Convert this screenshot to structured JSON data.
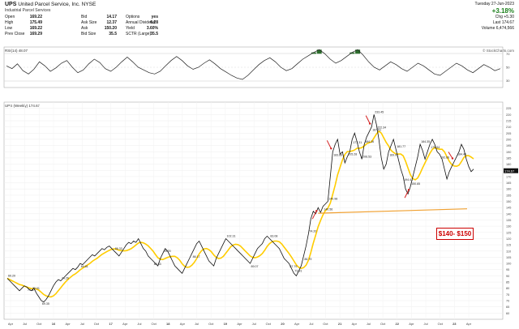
{
  "header": {
    "ticker": "UPS",
    "company": "United Parcel Service, Inc. NYSE",
    "industry": "Industrial Parcel Services",
    "credit": "© StockCharts.com",
    "date": "Tuesday 27-Jun-2023",
    "change_pct": "+3.18%",
    "change_abs": "+5.30",
    "quotes_left": [
      {
        "k": "Open",
        "v": "169.22"
      },
      {
        "k": "High",
        "v": "175.49"
      },
      {
        "k": "Low",
        "v": "169.22"
      },
      {
        "k": "Prev Close",
        "v": "169.29"
      }
    ],
    "quotes_mid": [
      {
        "k": "Bid",
        "v": "14.17"
      },
      {
        "k": "Ask Size",
        "v": "12.37"
      },
      {
        "k": "Ask",
        "v": "150.20"
      },
      {
        "k": "Bid Size",
        "v": "35.5"
      }
    ],
    "quotes_mid2": [
      {
        "k": "P/E",
        "v": "yes"
      },
      {
        "k": "EPS",
        "v": "6.28"
      },
      {
        "k": "Mkt Cap",
        "v": "3.60%"
      },
      {
        "k": "Last Size",
        "v": "35.5"
      }
    ],
    "quotes_mid3": [
      {
        "k": "Options",
        "v": "yes"
      },
      {
        "k": "Annual Dividend",
        "v": "6.28"
      },
      {
        "k": "Yield",
        "v": "3.60%"
      },
      {
        "k": "SCTR (Large)",
        "v": "35.5"
      }
    ],
    "quotes_right": [
      {
        "k": "Chg",
        "v": "+5.30"
      },
      {
        "k": "Last",
        "v": "174.67"
      },
      {
        "k": "Volume",
        "v": "6,474,566"
      }
    ]
  },
  "rsi_label": "RSI(14) 48.07",
  "price_label": "UPS (Weekly) 174.67",
  "price_tag": "174.67",
  "zone_label": "$140- $150",
  "colors": {
    "price_line": "#111111",
    "ma": "#ffcc00",
    "support": "#f0a030",
    "rsi_fill": "#2d6e2d",
    "arrow": "#d42020"
  },
  "chart_data": {
    "type": "line",
    "rsi": {
      "ylim": [
        20,
        80
      ],
      "ticks": [
        30,
        50,
        70
      ],
      "values": [
        52,
        48,
        55,
        45,
        40,
        47,
        58,
        52,
        44,
        49,
        56,
        60,
        50,
        42,
        46,
        55,
        62,
        57,
        48,
        44,
        50,
        58,
        65,
        58,
        50,
        46,
        42,
        40,
        44,
        52,
        60,
        66,
        60,
        52,
        47,
        50,
        56,
        61,
        55,
        48,
        43,
        38,
        34,
        32,
        38,
        46,
        54,
        60,
        64,
        58,
        50,
        45,
        48,
        55,
        62,
        67,
        72,
        76,
        70,
        62,
        56,
        60,
        66,
        72,
        76,
        68,
        58,
        50,
        46,
        52,
        58,
        54,
        48,
        44,
        50,
        56,
        52,
        46,
        40,
        38,
        44,
        50,
        56,
        52,
        46,
        42,
        48,
        54,
        50,
        45,
        48
      ]
    },
    "price": {
      "ylim": [
        55,
        230
      ],
      "y_ticks": [
        60,
        65,
        70,
        75,
        80,
        85,
        90,
        95,
        100,
        105,
        110,
        115,
        120,
        125,
        130,
        135,
        140,
        145,
        150,
        155,
        160,
        165,
        170,
        175,
        180,
        185,
        190,
        195,
        200,
        205,
        210,
        215,
        220,
        225
      ],
      "x_ticks": [
        "Apr",
        "Jul",
        "Oct",
        "16",
        "Apr",
        "Jul",
        "Oct",
        "17",
        "Apr",
        "Jul",
        "Oct",
        "18",
        "Apr",
        "Jul",
        "Oct",
        "19",
        "Apr",
        "Jul",
        "Oct",
        "20",
        "Apr",
        "Jul",
        "Oct",
        "21",
        "Apr",
        "Jul",
        "Oct",
        "22",
        "Apr",
        "Jul",
        "Oct",
        "23",
        "Apr"
      ],
      "points": [
        88,
        86,
        84,
        82,
        80,
        78,
        80,
        82,
        81,
        79,
        78,
        80,
        76,
        73,
        70,
        69,
        71,
        74,
        78,
        82,
        85,
        87,
        86,
        88,
        90,
        92,
        94,
        96,
        95,
        97,
        100,
        99,
        101,
        103,
        105,
        107,
        106,
        108,
        110,
        112,
        111,
        113,
        114,
        112,
        110,
        108,
        106,
        109,
        112,
        115,
        117,
        116,
        118,
        117,
        120,
        116,
        112,
        110,
        106,
        104,
        102,
        100,
        98,
        104,
        108,
        112,
        110,
        106,
        102,
        98,
        96,
        94,
        92,
        96,
        100,
        104,
        108,
        112,
        116,
        118,
        114,
        110,
        106,
        102,
        100,
        98,
        104,
        108,
        112,
        116,
        120,
        118,
        116,
        114,
        112,
        110,
        108,
        106,
        104,
        102,
        100,
        104,
        108,
        112,
        114,
        116,
        120,
        122,
        120,
        118,
        116,
        114,
        112,
        108,
        104,
        102,
        100,
        96,
        92,
        90,
        94,
        98,
        106,
        114,
        124,
        136,
        142,
        140,
        145,
        141,
        146,
        148,
        150,
        170,
        190,
        196,
        200,
        188,
        190,
        181,
        186,
        190,
        200,
        205,
        198,
        190,
        184,
        196,
        202,
        206,
        210,
        220,
        212,
        200,
        185,
        176,
        180,
        190,
        195,
        200,
        192,
        184,
        176,
        170,
        160,
        156,
        162,
        170,
        178,
        186,
        196,
        191,
        184,
        190,
        196,
        200,
        196,
        190,
        188,
        184,
        176,
        168,
        174,
        178,
        182,
        186,
        190,
        196,
        192,
        184,
        178,
        174,
        176
      ],
      "annotations": [
        "60.20",
        "73.67",
        "73.01",
        "69.35",
        "74.26",
        "84.81",
        "86.33",
        "80.33",
        "78.20",
        "86.17",
        "102.31",
        "89.07",
        "83.08",
        "87.79",
        "73.91",
        "86.79",
        "74.20",
        "140.56",
        "140.98",
        "183.89",
        "205.28",
        "177.31",
        "206.53",
        "167.51",
        "184.26",
        "222.34",
        "233.45",
        "169.02",
        "181.77",
        "194.41",
        "184.35",
        "170.34",
        "150.85",
        "192.66",
        "184.49"
      ],
      "support_level": [
        140,
        150
      ]
    }
  }
}
